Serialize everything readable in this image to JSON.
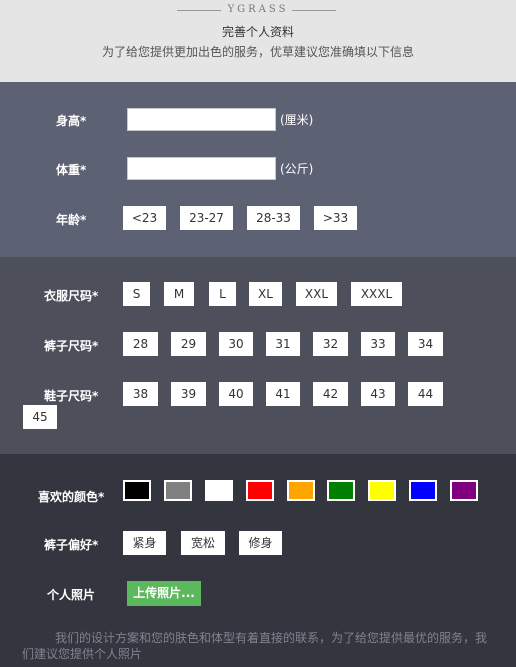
{
  "header": {
    "brand": "YGRASS",
    "title": "完善个人资料",
    "subtitle": "为了给您提供更加出色的服务，优草建议您准确填以下信息"
  },
  "basic": {
    "height": {
      "label": "身高*",
      "value": "",
      "unit": "(厘米)"
    },
    "weight": {
      "label": "体重*",
      "value": "",
      "unit": "(公斤)"
    },
    "age": {
      "label": "年龄*",
      "options": [
        "<23",
        "23-27",
        "28-33",
        ">33"
      ]
    }
  },
  "sizes": {
    "clothing": {
      "label": "衣服尺码*",
      "options": [
        "S",
        "M",
        "L",
        "XL",
        "XXL",
        "XXXL"
      ]
    },
    "pants": {
      "label": "裤子尺码*",
      "options": [
        "28",
        "29",
        "30",
        "31",
        "32",
        "33",
        "34"
      ]
    },
    "shoes": {
      "label": "鞋子尺码*",
      "options": [
        "38",
        "39",
        "40",
        "41",
        "42",
        "43",
        "44",
        "45"
      ]
    }
  },
  "prefs": {
    "color": {
      "label": "喜欢的颜色*",
      "swatches": [
        "#000000",
        "#808080",
        "#ffffff",
        "#ff0000",
        "#ffa500",
        "#008000",
        "#ffff00",
        "#0000ff",
        "#800080"
      ]
    },
    "fit": {
      "label": "裤子偏好*",
      "options": [
        "紧身",
        "宽松",
        "修身"
      ]
    },
    "photo": {
      "label": "个人照片",
      "button": "上传照片..."
    },
    "note": "我们的设计方案和您的肤色和体型有着直接的联系，为了给您提供最优的服务，我们建议您提供个人照片"
  }
}
